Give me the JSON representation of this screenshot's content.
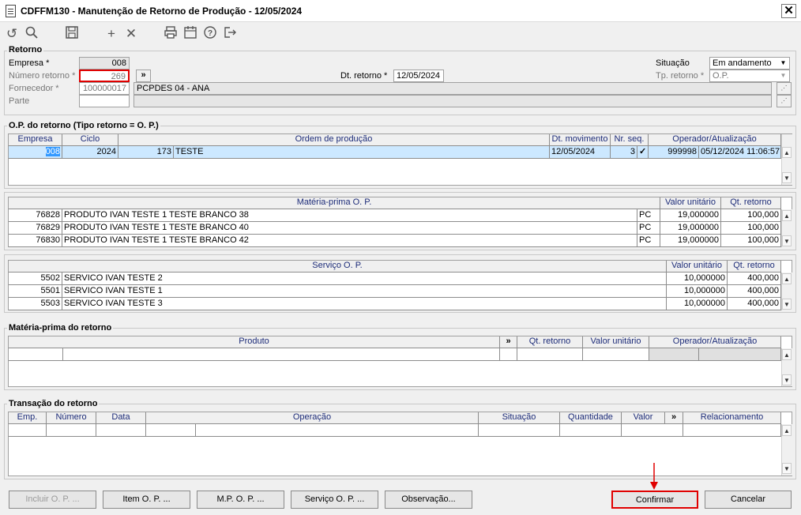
{
  "window": {
    "title": "CDFFM130 - Manutenção de Retorno de Produção - 12/05/2024",
    "close_label": "✕"
  },
  "toolbar": {
    "icons": [
      "undo-icon",
      "search-icon",
      "save-icon",
      "add-icon",
      "delete-icon",
      "print-icon",
      "calendar-icon",
      "help-icon",
      "exit-icon"
    ]
  },
  "retorno": {
    "title": "Retorno",
    "empresa_label": "Empresa *",
    "empresa_value": "008",
    "numero_label": "Número retorno *",
    "numero_value": "269",
    "nav_label": "»",
    "fornecedor_label": "Fornecedor *",
    "fornecedor_code": "100000017",
    "fornecedor_name": "PCPDES 04 - ANA",
    "parte_label": "Parte",
    "parte_value": "",
    "dt_label": "Dt. retorno *",
    "dt_value": "12/05/2024",
    "situacao_label": "Situação",
    "situacao_value": "Em andamento",
    "tp_label": "Tp. retorno *",
    "tp_value": "O.P."
  },
  "op": {
    "title": "O.P. do retorno (Tipo retorno = O. P.)",
    "headers": [
      "Empresa",
      "Ciclo",
      "Ordem de produção",
      "Dt. movimento",
      "Nr. seq.",
      "Operador/Atualização"
    ],
    "row": {
      "empresa": "008",
      "ciclo": "2024",
      "ordem": "173",
      "desc": "TESTE",
      "dt": "12/05/2024",
      "seq": "3",
      "check": "✓",
      "operador": "999998",
      "atualizacao": "05/12/2024 11:06:57"
    }
  },
  "materia_op": {
    "headers": [
      "Matéria-prima O. P.",
      "Valor unitário",
      "Qt. retorno"
    ],
    "rows": [
      {
        "code": "76828",
        "desc": "PRODUTO IVAN TESTE 1 TESTE BRANCO 38",
        "un": "PC",
        "valor": "19,000000",
        "qt": "100,000"
      },
      {
        "code": "76829",
        "desc": "PRODUTO IVAN TESTE 1 TESTE BRANCO 40",
        "un": "PC",
        "valor": "19,000000",
        "qt": "100,000"
      },
      {
        "code": "76830",
        "desc": "PRODUTO IVAN TESTE 1 TESTE BRANCO 42",
        "un": "PC",
        "valor": "19,000000",
        "qt": "100,000"
      }
    ]
  },
  "servico_op": {
    "headers": [
      "Serviço O. P.",
      "Valor unitário",
      "Qt. retorno"
    ],
    "rows": [
      {
        "code": "5502",
        "desc": "SERVICO IVAN TESTE 2",
        "valor": "10,000000",
        "qt": "400,000"
      },
      {
        "code": "5501",
        "desc": "SERVICO IVAN TESTE 1",
        "valor": "10,000000",
        "qt": "400,000"
      },
      {
        "code": "5503",
        "desc": "SERVICO IVAN TESTE 3",
        "valor": "10,000000",
        "qt": "400,000"
      }
    ]
  },
  "materia_ret": {
    "title": "Matéria-prima do retorno",
    "headers": [
      "Produto",
      "»",
      "Qt. retorno",
      "Valor unitário",
      "Operador/Atualização"
    ]
  },
  "transacao": {
    "title": "Transação do retorno",
    "headers": [
      "Emp.",
      "Número",
      "Data",
      "Operação",
      "Situação",
      "Quantidade",
      "Valor",
      "»",
      "Relacionamento"
    ]
  },
  "buttons": {
    "incluir": "Incluir O. P. ...",
    "item": "Item O. P. ...",
    "mp": "M.P. O. P. ...",
    "servico": "Serviço O. P. ...",
    "observacao": "Observação...",
    "confirmar": "Confirmar",
    "cancelar": "Cancelar"
  },
  "colors": {
    "highlight_red": "#e00000",
    "selected_row": "#cce8ff",
    "header_text": "#1c2b78"
  }
}
